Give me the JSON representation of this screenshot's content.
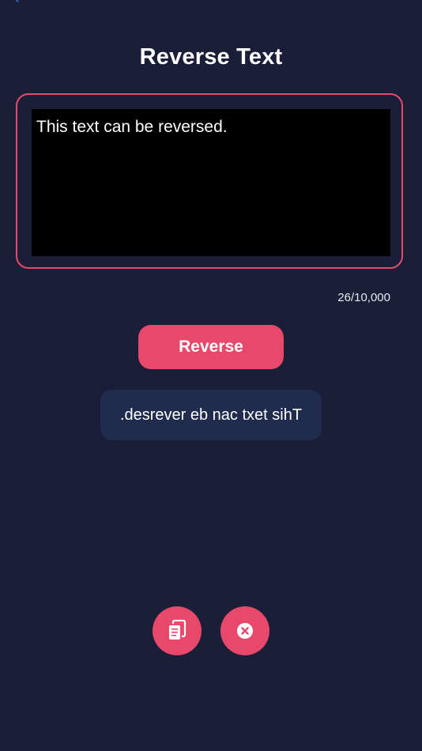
{
  "header": {
    "title": "Reverse Text"
  },
  "input": {
    "value": "This text can be reversed.",
    "char_count": "26/10,000"
  },
  "actions": {
    "reverse_label": "Reverse"
  },
  "output": {
    "value": ".desrever eb nac txet sihT"
  },
  "icons": {
    "copy": "copy-icon",
    "clear": "clear-icon"
  },
  "colors": {
    "background": "#1b1e38",
    "accent": "#e8496a",
    "input_bg": "#000000",
    "output_bg": "#1f2c4d"
  }
}
